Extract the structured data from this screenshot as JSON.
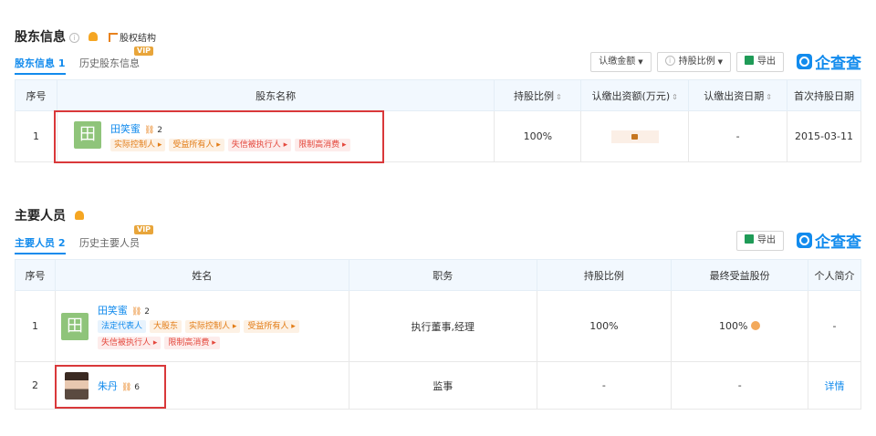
{
  "shareholders": {
    "title": "股东信息",
    "structure_link": "股权结构",
    "vip_badge": "VIP",
    "tabs": [
      {
        "label": "股东信息",
        "count": "1"
      },
      {
        "label": "历史股东信息"
      }
    ],
    "toolbar": {
      "subscribed_amount": "认缴金额",
      "share_ratio": "持股比例",
      "export": "导出",
      "brand": "企查查"
    },
    "columns": [
      "序号",
      "股东名称",
      "持股比例",
      "认缴出资额(万元)",
      "认缴出资日期",
      "首次持股日期"
    ],
    "rows": [
      {
        "index": "1",
        "avatar_char": "田",
        "name": "田笑蜜",
        "relation_count": "2",
        "tags": [
          "实际控制人",
          "受益所有人",
          "失信被执行人",
          "限制高消费"
        ],
        "share_ratio": "100%",
        "subscribed_date": "-",
        "first_hold_date": "2015-03-11"
      }
    ]
  },
  "personnel": {
    "title": "主要人员",
    "vip_badge": "VIP",
    "tabs": [
      {
        "label": "主要人员",
        "count": "2"
      },
      {
        "label": "历史主要人员"
      }
    ],
    "toolbar": {
      "export": "导出",
      "brand": "企查查"
    },
    "columns": [
      "序号",
      "姓名",
      "职务",
      "持股比例",
      "最终受益股份",
      "个人简介"
    ],
    "rows": [
      {
        "index": "1",
        "avatar_char": "田",
        "name": "田笑蜜",
        "relation_count": "2",
        "tags": [
          "法定代表人",
          "大股东",
          "实际控制人",
          "受益所有人",
          "失信被执行人",
          "限制高消费"
        ],
        "position": "执行董事,经理",
        "share_ratio": "100%",
        "beneficial_share": "100%",
        "profile": "-"
      },
      {
        "index": "2",
        "name": "朱丹",
        "relation_count": "6",
        "position": "监事",
        "share_ratio": "-",
        "beneficial_share": "-",
        "profile": "详情"
      }
    ]
  }
}
